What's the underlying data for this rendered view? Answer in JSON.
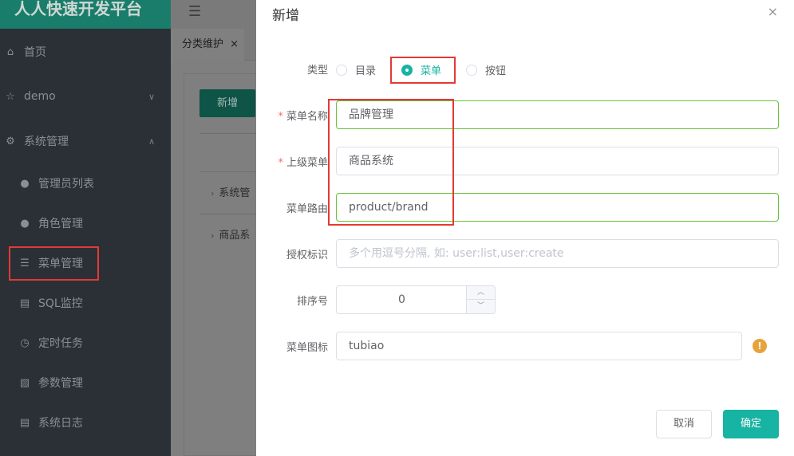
{
  "sidebar": {
    "brand": "人人快速开发平台",
    "items": [
      {
        "label": "首页",
        "icon": "home-icon"
      },
      {
        "label": "demo",
        "icon": "star-icon"
      },
      {
        "label": "系统管理",
        "icon": "gear-icon"
      },
      {
        "label": "管理员列表",
        "icon": "user-icon"
      },
      {
        "label": "角色管理",
        "icon": "role-icon"
      },
      {
        "label": "菜单管理",
        "icon": "list-icon"
      },
      {
        "label": "SQL监控",
        "icon": "monitor-icon"
      },
      {
        "label": "定时任务",
        "icon": "clock-icon"
      },
      {
        "label": "参数管理",
        "icon": "doc-settings-icon"
      },
      {
        "label": "系统日志",
        "icon": "log-icon"
      }
    ]
  },
  "tabs": [
    {
      "label": "分类维护",
      "close": "×"
    }
  ],
  "main": {
    "add_button": "新增",
    "tree_rows": [
      "系统管",
      "商品系"
    ]
  },
  "dialog": {
    "title": "新增",
    "close": "×",
    "type": {
      "label": "类型",
      "options": [
        "目录",
        "菜单",
        "按钮"
      ],
      "selected": "菜单"
    },
    "name": {
      "label": "菜单名称",
      "value": "品牌管理",
      "required": true
    },
    "parent": {
      "label": "上级菜单",
      "value": "商品系统",
      "required": true
    },
    "route": {
      "label": "菜单路由",
      "value": "product/brand"
    },
    "perms": {
      "label": "授权标识",
      "placeholder": "多个用逗号分隔, 如: user:list,user:create"
    },
    "order": {
      "label": "排序号",
      "value": "0"
    },
    "icon": {
      "label": "菜单图标",
      "value": "tubiao",
      "hint": "!"
    },
    "cancel": "取消",
    "confirm": "确定"
  },
  "colors": {
    "accent": "#17b3a3",
    "valid": "#67c23a",
    "required": "#f56c6c",
    "warning": "#e6a23c",
    "annotation": "#e53935"
  }
}
